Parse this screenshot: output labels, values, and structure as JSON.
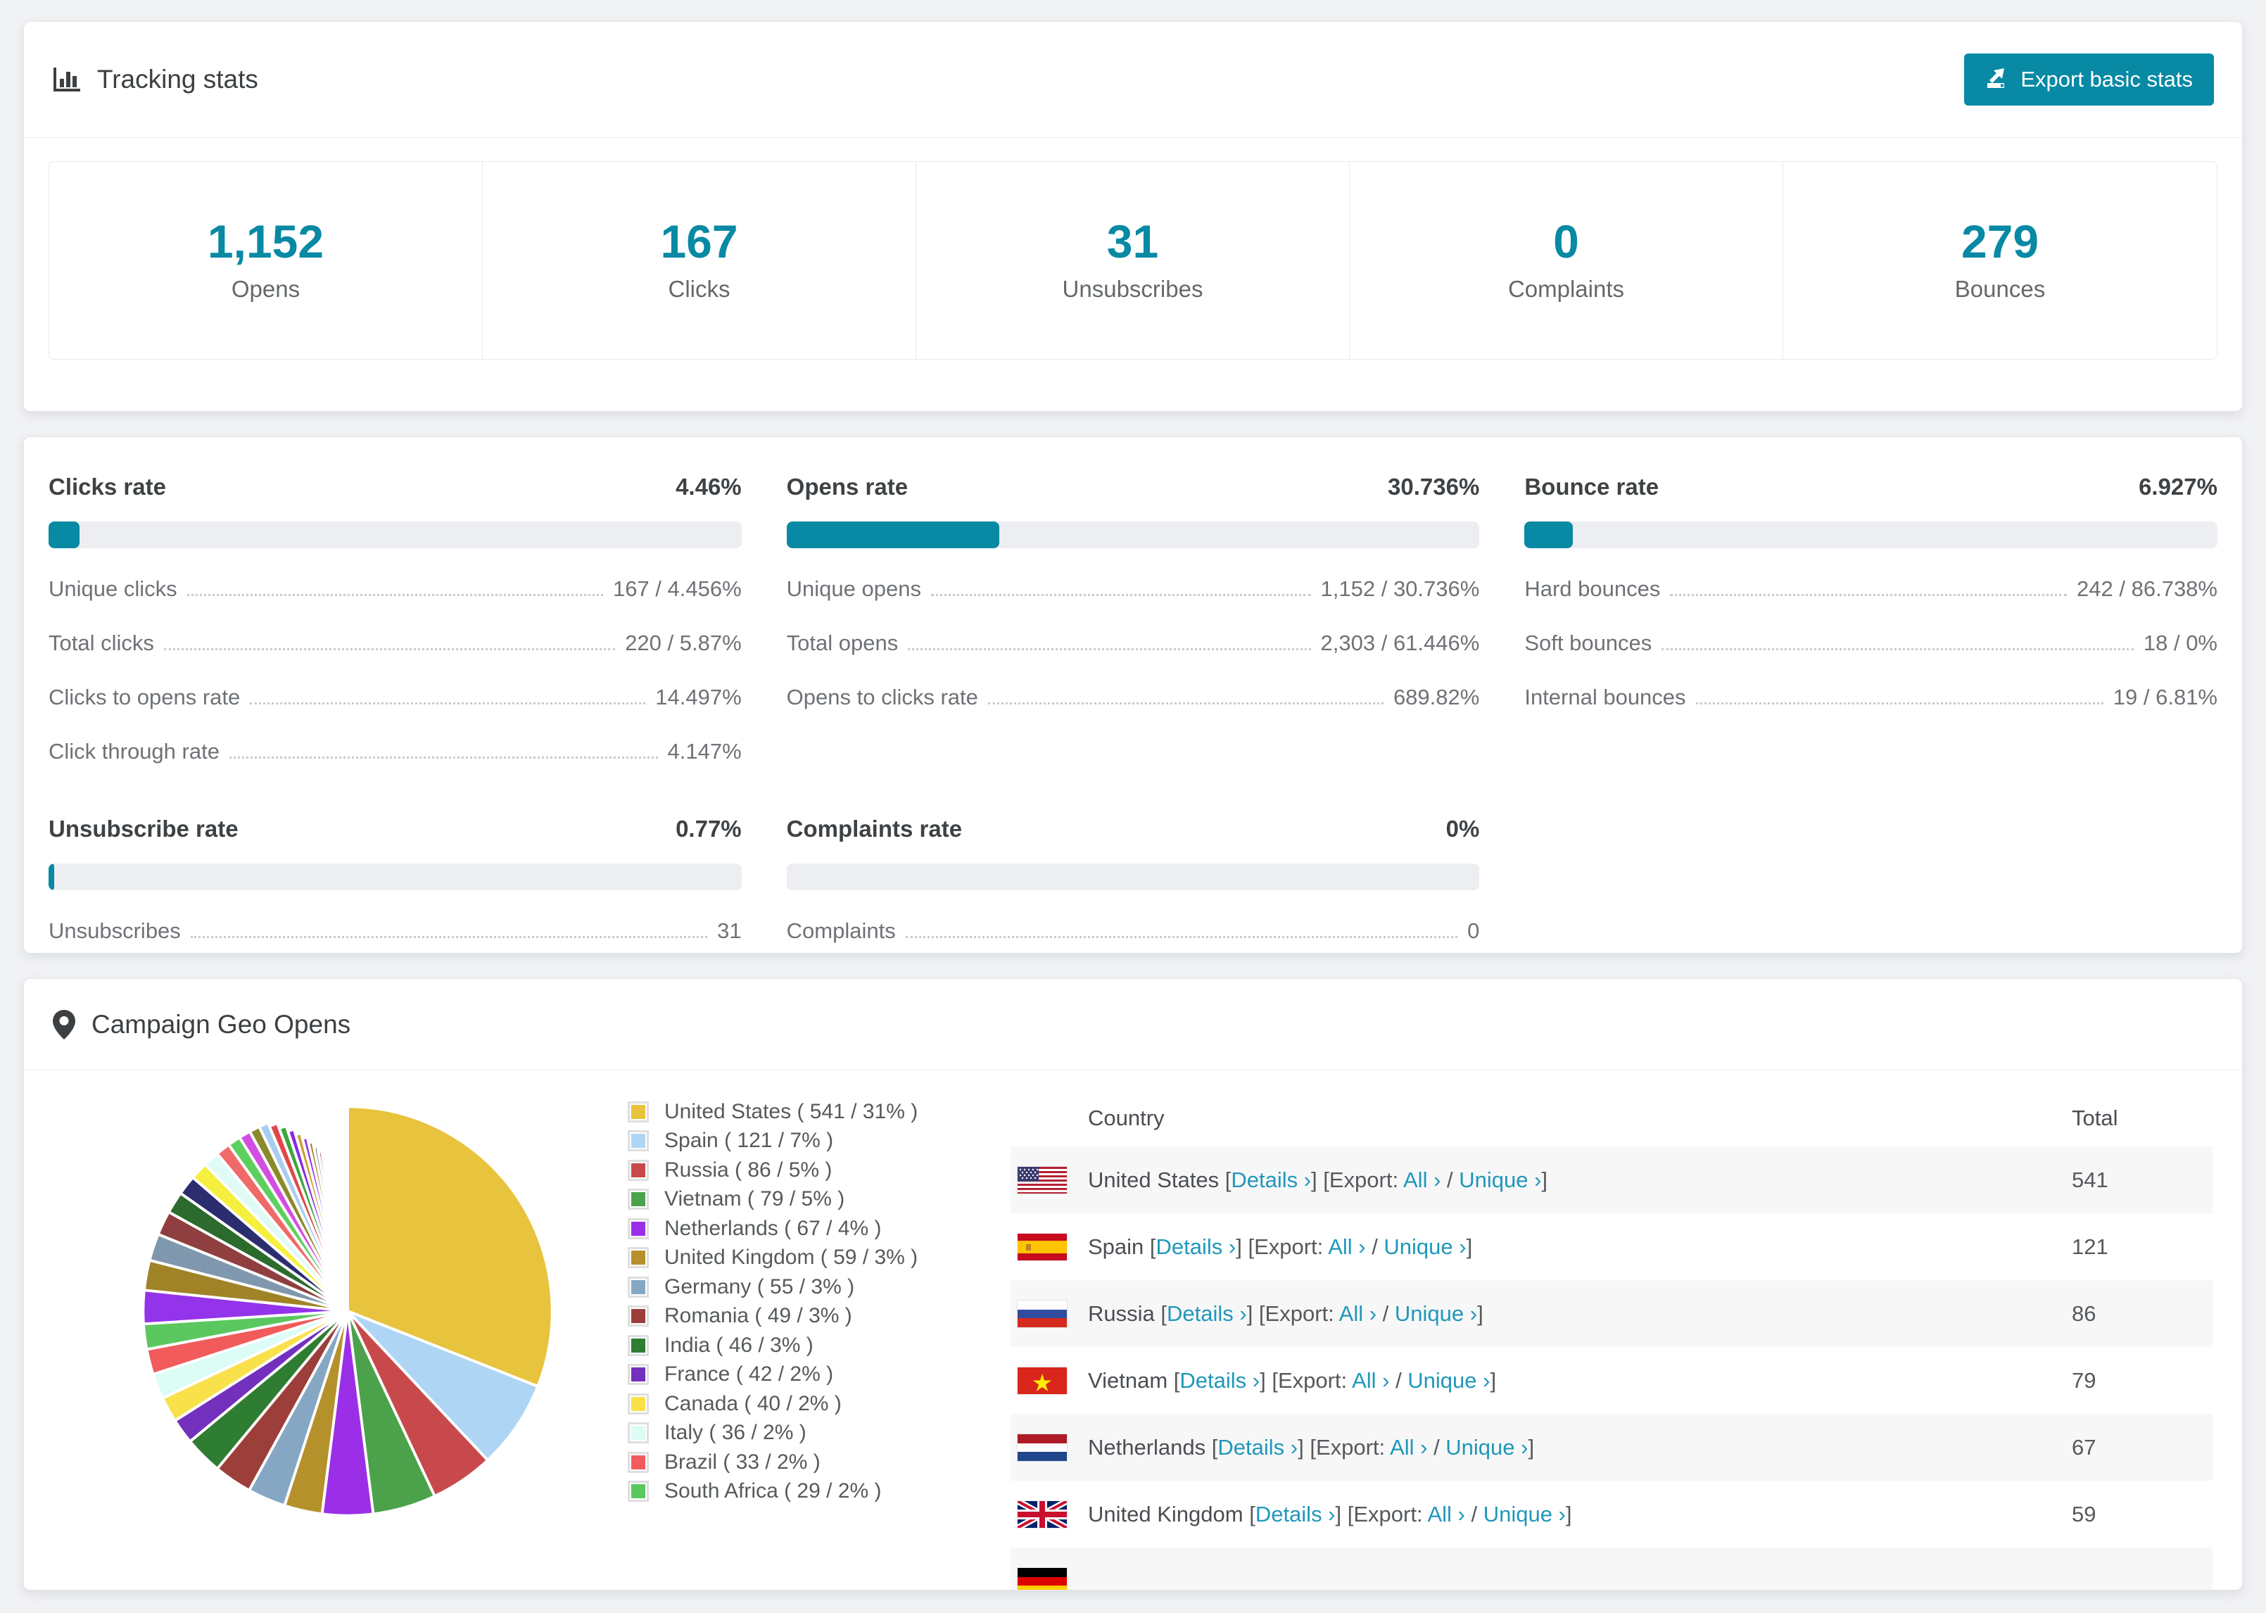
{
  "accent_color": "#0889a4",
  "link_color": "#2097ba",
  "tracking": {
    "title": "Tracking stats",
    "export_label": "Export basic stats",
    "stats": [
      {
        "value": "1,152",
        "label": "Opens"
      },
      {
        "value": "167",
        "label": "Clicks"
      },
      {
        "value": "31",
        "label": "Unsubscribes"
      },
      {
        "value": "0",
        "label": "Complaints"
      },
      {
        "value": "279",
        "label": "Bounces"
      }
    ]
  },
  "rates": {
    "sections": [
      {
        "title": "Clicks rate",
        "value": "4.46%",
        "bar_pct": 4.46,
        "rows": [
          {
            "label": "Unique clicks",
            "value": "167 / 4.456%"
          },
          {
            "label": "Total clicks",
            "value": "220 / 5.87%"
          },
          {
            "label": "Clicks to opens rate",
            "value": "14.497%"
          },
          {
            "label": "Click through rate",
            "value": "4.147%"
          }
        ]
      },
      {
        "title": "Opens rate",
        "value": "30.736%",
        "bar_pct": 30.736,
        "rows": [
          {
            "label": "Unique opens",
            "value": "1,152 / 30.736%"
          },
          {
            "label": "Total opens",
            "value": "2,303 / 61.446%"
          },
          {
            "label": "Opens to clicks rate",
            "value": "689.82%"
          }
        ]
      },
      {
        "title": "Bounce rate",
        "value": "6.927%",
        "bar_pct": 6.927,
        "rows": [
          {
            "label": "Hard bounces",
            "value": "242 / 86.738%"
          },
          {
            "label": "Soft bounces",
            "value": "18 / 0%"
          },
          {
            "label": "Internal bounces",
            "value": "19 / 6.81%"
          }
        ]
      },
      {
        "title": "Unsubscribe rate",
        "value": "0.77%",
        "bar_pct": 0.77,
        "rows": [
          {
            "label": "Unsubscribes",
            "value": "31"
          }
        ]
      },
      {
        "title": "Complaints rate",
        "value": "0%",
        "bar_pct": 0,
        "rows": [
          {
            "label": "Complaints",
            "value": "0"
          }
        ]
      }
    ]
  },
  "geo": {
    "title": "Campaign Geo Opens",
    "table_headers": [
      "Country",
      "Total"
    ],
    "link_labels": {
      "details": "Details ›",
      "export_prefix": "[Export: ",
      "all": "All ›",
      "slash": " / ",
      "unique": "Unique ›",
      "open_bracket": "[",
      "close_bracket": "]"
    },
    "rows": [
      {
        "flag": "us",
        "country": "United States",
        "total": "541",
        "striped": true
      },
      {
        "flag": "es",
        "country": "Spain",
        "total": "121",
        "striped": false
      },
      {
        "flag": "ru",
        "country": "Russia",
        "total": "86",
        "striped": true
      },
      {
        "flag": "vn",
        "country": "Vietnam",
        "total": "79",
        "striped": false
      },
      {
        "flag": "nl",
        "country": "Netherlands",
        "total": "67",
        "striped": true
      },
      {
        "flag": "gb",
        "country": "United Kingdom",
        "total": "59",
        "striped": false
      },
      {
        "flag": "de",
        "country": "",
        "total": "",
        "striped": true,
        "partial": true
      }
    ]
  },
  "chart_data": {
    "type": "pie",
    "title": "Campaign Geo Opens",
    "legend_position": "right",
    "slices": [
      {
        "label": "United States",
        "value": 541,
        "pct": 31,
        "color": "#e8c33d"
      },
      {
        "label": "Spain",
        "value": 121,
        "pct": 7,
        "color": "#aed5f4"
      },
      {
        "label": "Russia",
        "value": 86,
        "pct": 5,
        "color": "#c8494c"
      },
      {
        "label": "Vietnam",
        "value": 79,
        "pct": 5,
        "color": "#4ba24b"
      },
      {
        "label": "Netherlands",
        "value": 67,
        "pct": 4,
        "color": "#9b2fe8"
      },
      {
        "label": "United Kingdom",
        "value": 59,
        "pct": 3,
        "color": "#b5912b"
      },
      {
        "label": "Germany",
        "value": 55,
        "pct": 3,
        "color": "#85a7c4"
      },
      {
        "label": "Romania",
        "value": 49,
        "pct": 3,
        "color": "#9c3f3a"
      },
      {
        "label": "India",
        "value": 46,
        "pct": 3,
        "color": "#2f7d33"
      },
      {
        "label": "France",
        "value": 42,
        "pct": 2,
        "color": "#7330bd"
      },
      {
        "label": "Canada",
        "value": 40,
        "pct": 2,
        "color": "#f8e14b"
      },
      {
        "label": "Italy",
        "value": 36,
        "pct": 2,
        "color": "#dcfcf6"
      },
      {
        "label": "Brazil",
        "value": 33,
        "pct": 2,
        "color": "#f15b5b"
      },
      {
        "label": "South Africa",
        "value": 29,
        "pct": 2,
        "color": "#5bc75f"
      }
    ],
    "unlabeled_tail": {
      "total_pct_estimate": 26,
      "slice_count_estimate": 42,
      "decay": 0.9,
      "palette": [
        "#9333ea",
        "#a08327",
        "#7f98ad",
        "#8f3f3f",
        "#2d6a2d",
        "#2b2d6e",
        "#f5ef3d",
        "#e0fbf5",
        "#f06a6a",
        "#5ecf5e",
        "#d24ee0",
        "#8a8a2a",
        "#a8cdf0",
        "#e04848",
        "#3da63d",
        "#8a2be2",
        "#c8a12e"
      ]
    }
  }
}
